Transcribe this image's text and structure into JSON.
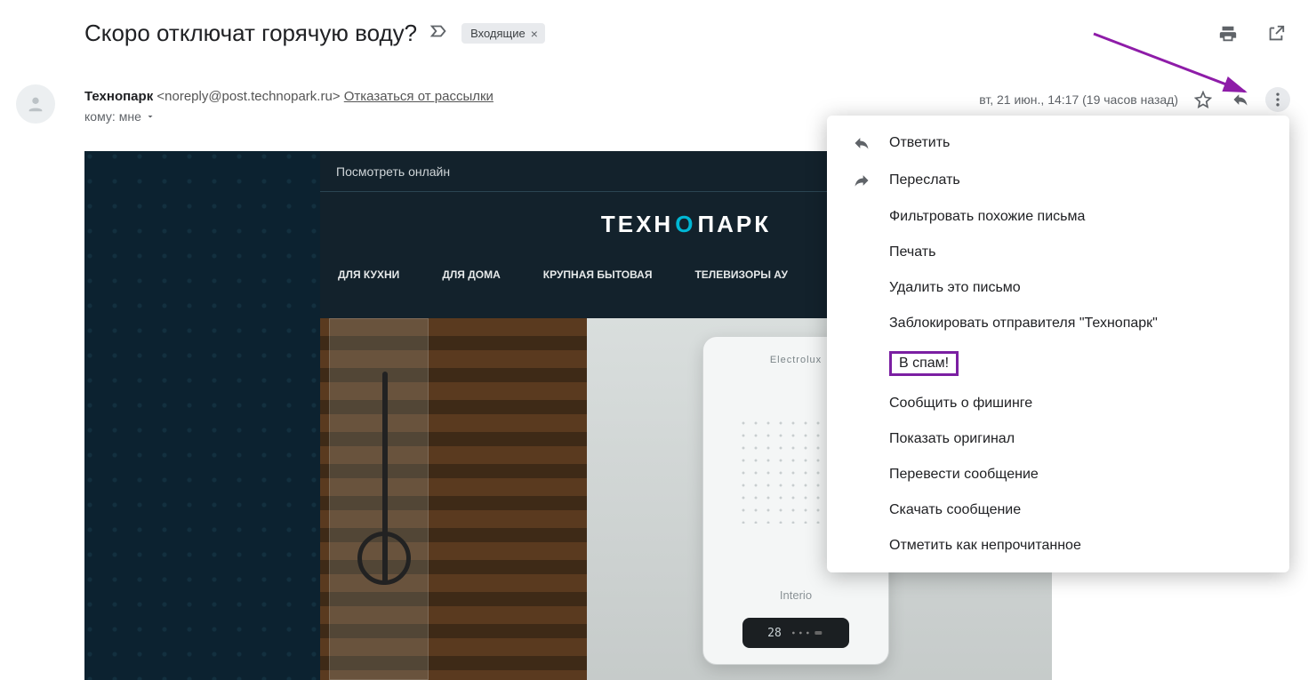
{
  "subject": "Скоро отключат горячую воду?",
  "inbox_chip": "Входящие",
  "sender_name": "Технопарк",
  "sender_email": "<noreply@post.technopark.ru>",
  "unsubscribe": "Отказаться от рассылки",
  "to_prefix": "кому:",
  "to_value": "мне",
  "timestamp": "вт, 21 июн., 14:17 (19 часов назад)",
  "email": {
    "view_online": "Посмотреть онлайн",
    "logo_pre": "ТЕХН",
    "logo_o": "О",
    "logo_post": "ПАРК",
    "nav": [
      "ДЛЯ КУХНИ",
      "ДЛЯ ДОМА",
      "КРУПНАЯ БЫТОВАЯ",
      "ТЕЛЕВИЗОРЫ АУ"
    ],
    "heater_brand": "Electrolux",
    "heater_model": "Interio",
    "heater_display": "28"
  },
  "menu": {
    "reply": "Ответить",
    "forward": "Переслать",
    "filter": "Фильтровать похожие письма",
    "print": "Печать",
    "delete": "Удалить это письмо",
    "block": "Заблокировать отправителя \"Технопарк\"",
    "spam": "В спам!",
    "phishing": "Сообщить о фишинге",
    "original": "Показать оригинал",
    "translate": "Перевести сообщение",
    "download": "Скачать сообщение",
    "unread": "Отметить как непрочитанное"
  }
}
